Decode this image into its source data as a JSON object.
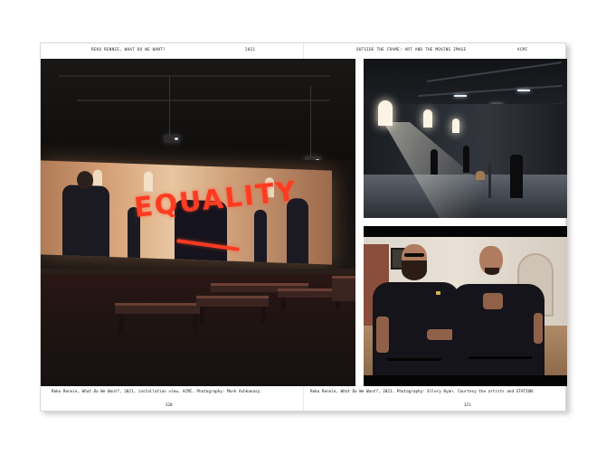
{
  "header": {
    "left_running_head": "REKO RENNIE, WHAT DO WE WANT?",
    "left_year": "2021",
    "right_running_head": "OUTSIDE THE FRAME: ART AND THE MOVING IMAGE",
    "right_brand": "ACMI"
  },
  "photos": {
    "left": {
      "graffiti_text": "EQUALITY"
    }
  },
  "captions": {
    "left_prefix": "Reko Rennie, ",
    "left_title": "What Do We Want?",
    "left_suffix": ", 2021, installation view, ACMI. Photography: Mark Ashkanasy.",
    "right_prefix": "Reko Rennie, ",
    "right_title": "What Do We Want?",
    "right_suffix": ", 2021. Photography: Ellery Ryan. Courtesy the artists and STATION."
  },
  "folios": {
    "left": "320",
    "right": "321"
  },
  "colors": {
    "graffiti_red": "#ff3b22",
    "page": "#ffffff"
  }
}
